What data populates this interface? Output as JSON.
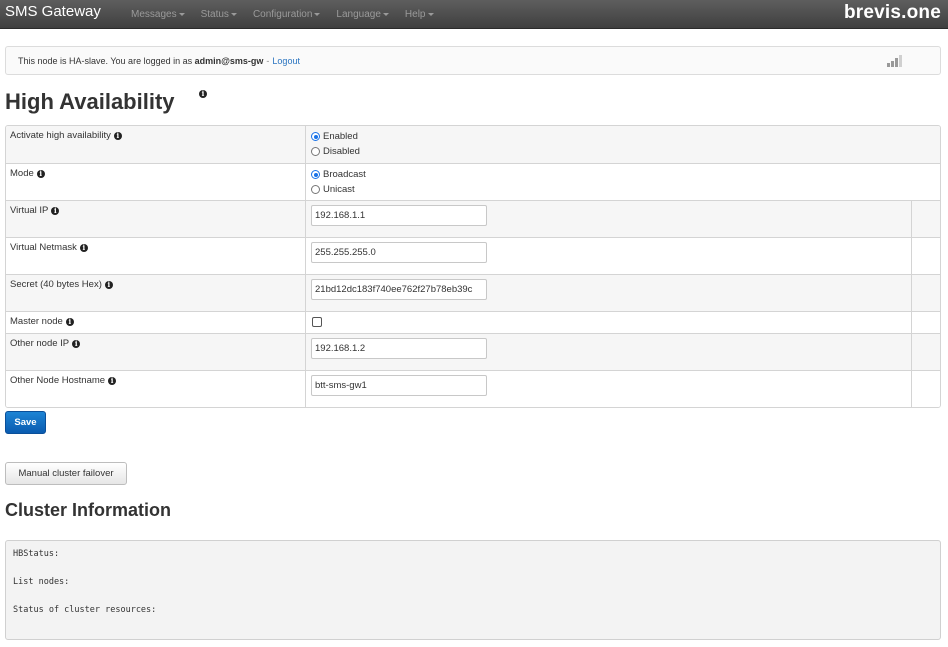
{
  "app": {
    "brand": "SMS Gateway",
    "logo": "brevis.one",
    "nav": [
      "Messages",
      "Status",
      "Configuration",
      "Language",
      "Help"
    ]
  },
  "status_bar": {
    "prefix": "This node is HA-slave. You are logged in as",
    "user": "admin@sms-gw",
    "separator": "-",
    "logout": "Logout",
    "signal_icon": "signal-strength-icon"
  },
  "page": {
    "title": "High Availability"
  },
  "settings": {
    "ha_label": "Activate high availability",
    "ha_options": [
      "Enabled",
      "Disabled"
    ],
    "ha_selected": "Enabled",
    "mode_label": "Mode",
    "mode_options": [
      "Broadcast",
      "Unicast"
    ],
    "mode_selected": "Broadcast",
    "virtual_ip_label": "Virtual IP",
    "virtual_ip_value": "192.168.1.1",
    "netmask_label": "Virtual Netmask",
    "netmask_value": "255.255.255.0",
    "secret_label": "Secret (40 bytes Hex)",
    "secret_value": "21bd12dc183f740ee762f27b78eb39c",
    "master_label": "Master node",
    "master_checked": false,
    "other_ip_label": "Other node IP",
    "other_ip_value": "192.168.1.2",
    "other_host_label": "Other Node Hostname",
    "other_host_value": "btt-sms-gw1"
  },
  "buttons": {
    "save": "Save",
    "failover": "Manual cluster failover"
  },
  "cluster": {
    "title": "Cluster Information",
    "lines": [
      "HBStatus:",
      "List nodes:",
      "Status of cluster resources:"
    ]
  },
  "colors": {
    "navbar": "#4a4a4a",
    "primary_button": "#0f6cc2",
    "link": "#2a74c0",
    "radio_accent": "#1a73e8"
  }
}
